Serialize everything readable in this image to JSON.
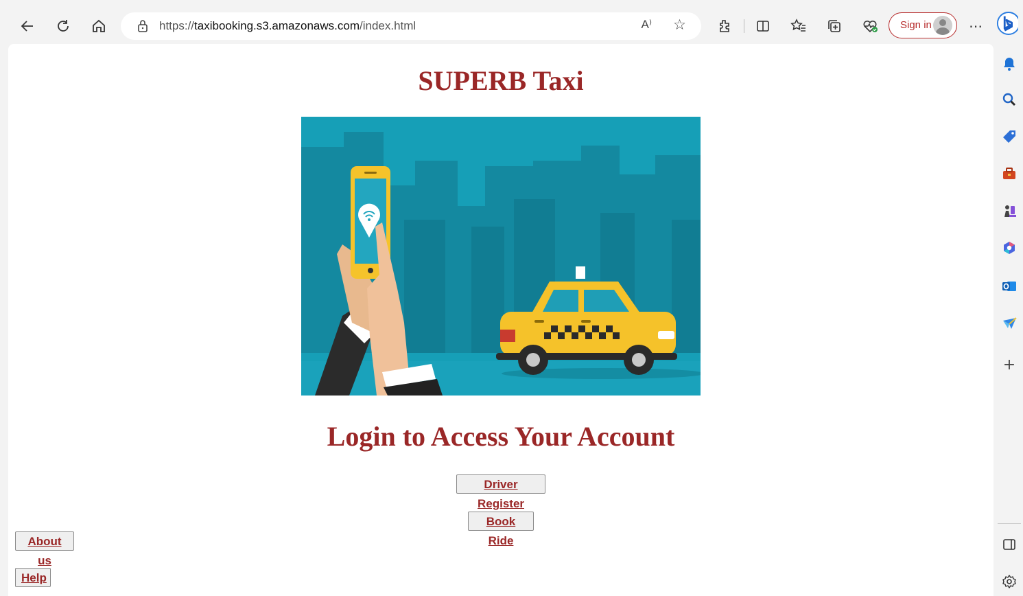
{
  "browser": {
    "url_prefix": "https://",
    "url_host": "taxibooking.s3.amazonaws.com",
    "url_path": "/index.html",
    "read_aloud_label": "A⁾",
    "sign_in_label": "Sign in",
    "more_label": "⋯"
  },
  "page": {
    "site_title": "SUPERB Taxi",
    "login_heading": "Login to Access Your Account",
    "buttons": {
      "driver_register": "Driver Register",
      "book_ride": "Book Ride",
      "about_us": "About us",
      "help": "Help"
    }
  },
  "colors": {
    "brand_red": "#9a2727",
    "hero_bg": "#159fb8",
    "taxi_yellow": "#f5c22a"
  }
}
